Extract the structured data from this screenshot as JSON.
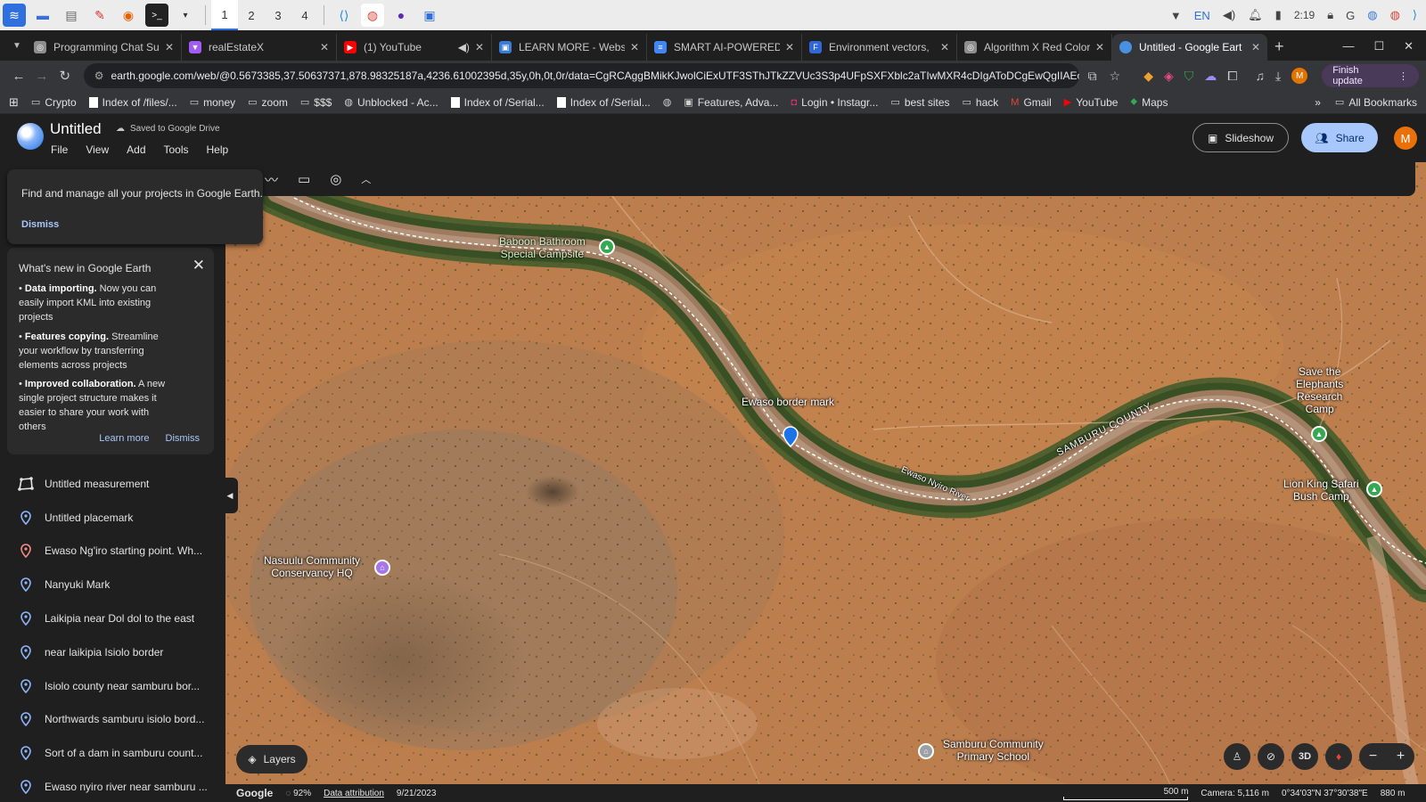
{
  "taskbar": {
    "workspaces": [
      "1",
      "2",
      "3",
      "4"
    ],
    "language": "EN",
    "time": "2:19"
  },
  "tabs": [
    {
      "title": "Programming Chat Su",
      "favicon_color": "#8e8e8e"
    },
    {
      "title": "realEstateX",
      "favicon_color": "#a15cf2"
    },
    {
      "title": "(1) YouTube",
      "favicon_color": "#ff0000"
    },
    {
      "title": "LEARN MORE - Websi",
      "favicon_color": "#3a7bd5"
    },
    {
      "title": "SMART AI-POWERED",
      "favicon_color": "#4285f4"
    },
    {
      "title": "Environment vectors,",
      "favicon_color": "#3167d6"
    },
    {
      "title": "Algorithm X Red Color",
      "favicon_color": "#8e8e8e"
    },
    {
      "title": "Untitled - Google Eart",
      "favicon_color": "#4a90e2"
    }
  ],
  "omnibox": {
    "url": "earth.google.com/web/@0.5673385,37.50637371,878.98325187a,4236.61002395d,35y,0h,0t,0r/data=CgRCAggBMikKJwolCiExUTF3SThJTkZZVUc3S3p4UFpSXFXblc2aTIwMXR4cDIgAToDCgEwQgIIAEoICJ2y3..."
  },
  "finish_update_label": "Finish update",
  "bookmarks": [
    {
      "label": "Crypto",
      "icon": "folder-icon"
    },
    {
      "label": "Index of /files/...",
      "icon": "page-icon"
    },
    {
      "label": "money",
      "icon": "folder-icon"
    },
    {
      "label": "zoom",
      "icon": "folder-icon"
    },
    {
      "label": "$$$",
      "icon": "folder-icon"
    },
    {
      "label": "Unblocked - Ac...",
      "icon": "globe-icon"
    },
    {
      "label": "Index of /Serial...",
      "icon": "page-icon"
    },
    {
      "label": "Index of /Serial...",
      "icon": "page-icon"
    },
    {
      "label": "",
      "icon": "globe-icon"
    },
    {
      "label": "Features, Adva...",
      "icon": "page-icon"
    },
    {
      "label": "Login • Instagr...",
      "icon": "instagram-icon"
    },
    {
      "label": "best sites",
      "icon": "folder-icon"
    },
    {
      "label": "hack",
      "icon": "folder-icon"
    },
    {
      "label": "Gmail",
      "icon": "gmail-icon"
    },
    {
      "label": "YouTube",
      "icon": "youtube-icon"
    },
    {
      "label": "Maps",
      "icon": "maps-icon"
    }
  ],
  "all_bookmarks_label": "All Bookmarks",
  "earth": {
    "title": "Untitled",
    "saved_status": "Saved to Google Drive",
    "menu": [
      "File",
      "View",
      "Add",
      "Tools",
      "Help"
    ],
    "slideshow_label": "Slideshow",
    "share_label": "Share",
    "avatar_initial": "M"
  },
  "projects_tip": {
    "message": "Find and manage all your projects in Google Earth.",
    "dismiss_label": "Dismiss"
  },
  "whats_new": {
    "heading": "What's new in Google Earth",
    "items": [
      {
        "bold": "Data importing.",
        "text": " Now you can easily import KML into existing projects"
      },
      {
        "bold": "Features copying.",
        "text": " Streamline your workflow by transferring elements across projects"
      },
      {
        "bold": "Improved collaboration.",
        "text": " A new single project structure makes it easier to share your work with others"
      }
    ],
    "learn_more_label": "Learn more",
    "dismiss_label": "Dismiss"
  },
  "features": [
    {
      "label": "Untitled measurement",
      "icon": "measurement-icon",
      "color": "#e3e3e3"
    },
    {
      "label": "Untitled placemark",
      "icon": "placemark-icon",
      "color": "#8ab4f8"
    },
    {
      "label": "Ewaso Ng'iro starting point. Wh...",
      "icon": "placemark-icon",
      "color": "#f28b82"
    },
    {
      "label": "Nanyuki Mark",
      "icon": "placemark-icon",
      "color": "#8ab4f8"
    },
    {
      "label": "Laikipia near Dol dol to the east",
      "icon": "placemark-icon",
      "color": "#8ab4f8"
    },
    {
      "label": "near laikipia Isiolo border",
      "icon": "placemark-icon",
      "color": "#8ab4f8"
    },
    {
      "label": "Isiolo county near samburu bor...",
      "icon": "placemark-icon",
      "color": "#8ab4f8"
    },
    {
      "label": "Northwards samburu isiolo bord...",
      "icon": "placemark-icon",
      "color": "#8ab4f8"
    },
    {
      "label": "Sort of a dam in samburu count...",
      "icon": "placemark-icon",
      "color": "#8ab4f8"
    },
    {
      "label": "Ewaso nyiro river near samburu ...",
      "icon": "placemark-icon",
      "color": "#8ab4f8"
    }
  ],
  "map": {
    "labels": {
      "baboon": "Baboon Bathroom\nSpecial Campsite",
      "ewaso_border": "Ewaso border mark",
      "save_elephants": "Save the\nElephants\nResearch\nCamp",
      "lion_king": "Lion King Safari\nBush Camp",
      "nasuulu": "Nasuulu Community\nConservancy HQ",
      "samburu_school": "Samburu Community\nPrimary School",
      "samburu_county": "SAMBURU COUNTY",
      "river": "Ewaso Nyiro River"
    },
    "layers_label": "Layers",
    "three_d_label": "3D"
  },
  "status": {
    "brand": "Google",
    "loading": "92%",
    "data_attribution": "Data attribution",
    "imagery_date": "9/21/2023",
    "scale": "500 m",
    "camera": "Camera: 5,116 m",
    "coordinates": "0°34'03\"N 37°30'38\"E",
    "elevation": "880 m"
  }
}
